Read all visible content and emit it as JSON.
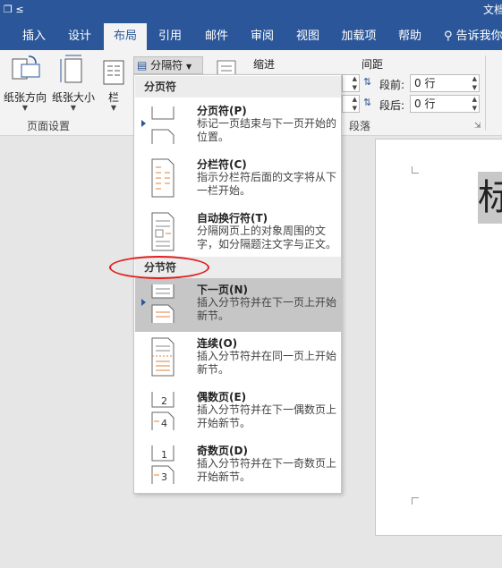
{
  "window": {
    "quick_access": "❒ ≤",
    "doc_title": "文档"
  },
  "tabs": [
    {
      "label": "插入"
    },
    {
      "label": "设计"
    },
    {
      "label": "布局"
    },
    {
      "label": "引用"
    },
    {
      "label": "邮件"
    },
    {
      "label": "审阅"
    },
    {
      "label": "视图"
    },
    {
      "label": "加载项"
    },
    {
      "label": "帮助"
    }
  ],
  "search_hint": "告诉我你",
  "ribbon": {
    "orientation": "纸张方向",
    "size": "纸张大小",
    "columns": "栏",
    "page_setup_label": "页面设置",
    "breaks_button": "分隔符",
    "indent_label": "缩进",
    "spacing_label": "间距",
    "before_label": "段前:",
    "before_value": "0 行",
    "after_label": "段后:",
    "after_value": "0 行",
    "paragraph_label": "段落"
  },
  "document": {
    "heading_glyph": "标"
  },
  "menu": {
    "page_breaks_header": "分页符",
    "section_breaks_header": "分节符",
    "items": [
      {
        "title": "分页符(P)",
        "desc": "标记一页结束与下一页开始的位置。",
        "icon": "page-break-icon"
      },
      {
        "title": "分栏符(C)",
        "desc": "指示分栏符后面的文字将从下一栏开始。",
        "icon": "column-break-icon"
      },
      {
        "title": "自动换行符(T)",
        "desc": "分隔网页上的对象周围的文字，如分隔题注文字与正文。",
        "icon": "text-wrapping-break-icon"
      },
      {
        "title": "下一页(N)",
        "desc": "插入分节符并在下一页上开始新节。",
        "icon": "next-page-icon"
      },
      {
        "title": "连续(O)",
        "desc": "插入分节符并在同一页上开始新节。",
        "icon": "continuous-icon"
      },
      {
        "title": "偶数页(E)",
        "desc": "插入分节符并在下一偶数页上开始新节。",
        "icon": "even-page-icon"
      },
      {
        "title": "奇数页(D)",
        "desc": "插入分节符并在下一奇数页上开始新节。",
        "icon": "odd-page-icon"
      }
    ]
  },
  "colors": {
    "accent": "#2b579a",
    "highlight": "#c6c6c6",
    "annotation": "#e02020"
  }
}
